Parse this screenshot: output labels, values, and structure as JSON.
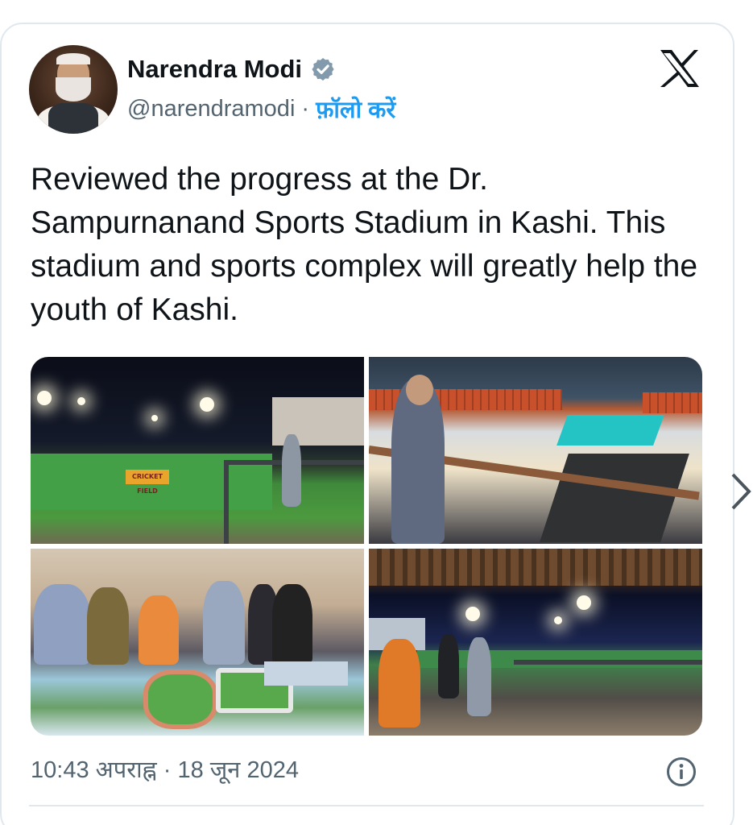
{
  "post": {
    "author": {
      "name": "Narendra Modi",
      "handle": "@narendramodi",
      "separator": "·",
      "follow_label": "फ़ॉलो करें",
      "verified_icon": "verified-badge-icon",
      "avatar": "profile-avatar"
    },
    "platform_icon": "x-logo-icon",
    "text": "Reviewed the progress at the Dr. Sampurnanand Sports Stadium in Kashi. This stadium and sports complex will greatly help the youth of Kashi.",
    "media": {
      "photos": [
        {
          "name": "stadium-night-cricket-field",
          "sign_text": "CRICKET FIELD"
        },
        {
          "name": "indoor-sports-hall"
        },
        {
          "name": "stadium-model-review"
        },
        {
          "name": "stadium-night-walk"
        }
      ]
    },
    "timestamp": {
      "time": "10:43 अपराह्न",
      "separator": "·",
      "date": "18 जून 2024"
    },
    "info_icon": "info-icon"
  },
  "colors": {
    "text_primary": "#0f1419",
    "text_secondary": "#536471",
    "accent": "#1d9bf0",
    "border": "#e1e8ed"
  },
  "navigation": {
    "prev_icon": "chevron-left-icon",
    "next_icon": "chevron-right-icon"
  }
}
